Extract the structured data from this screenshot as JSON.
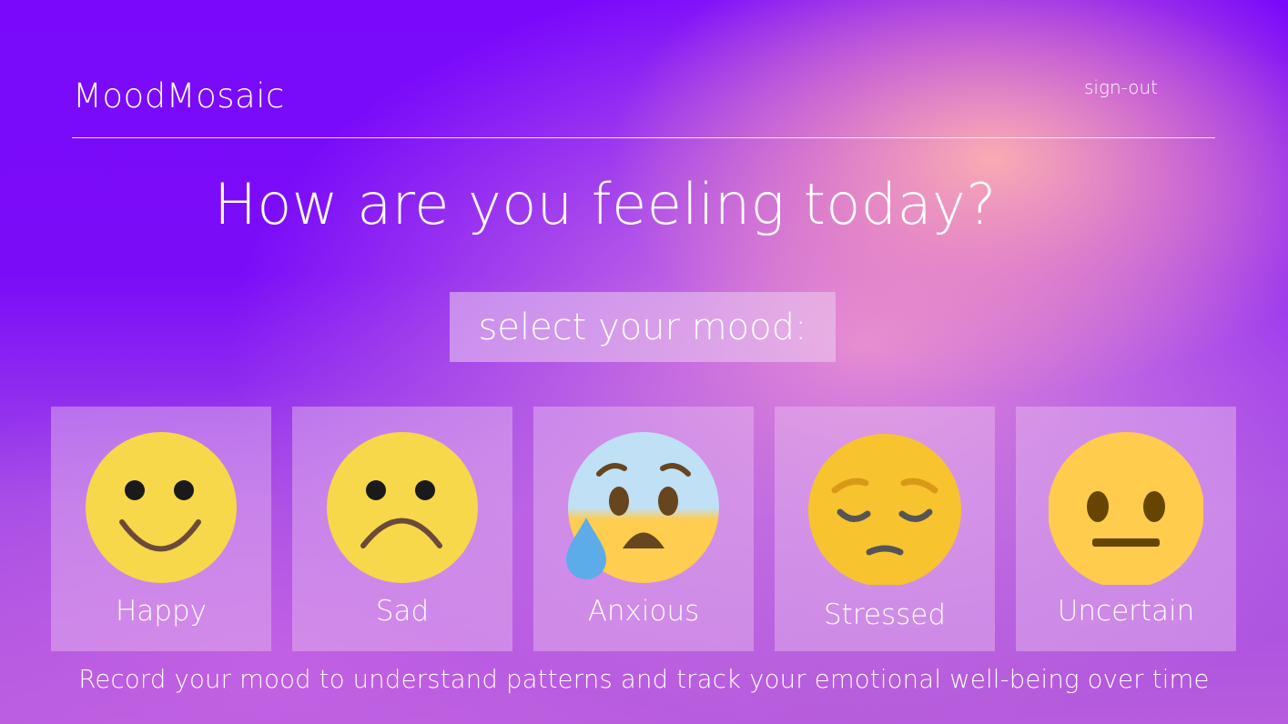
{
  "app": {
    "brand": "MoodMosaic",
    "sign_out": "sign-out"
  },
  "headline": "How are you feeling today?",
  "select_prompt": "select your mood:",
  "moods": [
    {
      "label": "Happy",
      "icon": "smiling-face-icon"
    },
    {
      "label": "Sad",
      "icon": "frowning-face-icon"
    },
    {
      "label": "Anxious",
      "icon": "anxious-face-with-sweat-icon"
    },
    {
      "label": "Stressed",
      "icon": "pensive-face-icon"
    },
    {
      "label": "Uncertain",
      "icon": "neutral-face-icon"
    }
  ],
  "footer": "Record your mood to understand patterns and track your emotional well-being over time",
  "colors": {
    "background_purple": "#7a09fb",
    "accent_pink": "#ffb0b0",
    "emoji_yellow": "#f6d84a"
  }
}
